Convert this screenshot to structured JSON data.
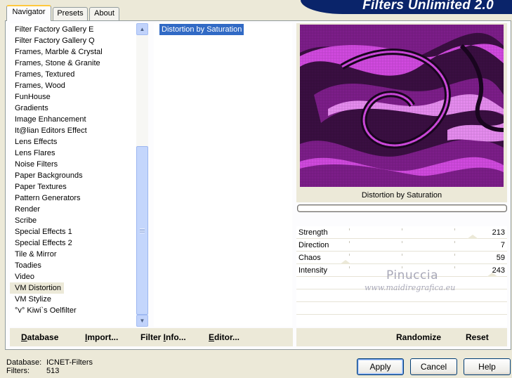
{
  "header": {
    "title": "Filters Unlimited 2.0"
  },
  "tabs": [
    {
      "label": "Navigator",
      "active": true
    },
    {
      "label": "Presets",
      "active": false
    },
    {
      "label": "About",
      "active": false
    }
  ],
  "categories": {
    "items": [
      "Filter Factory Gallery E",
      "Filter Factory Gallery Q",
      "Frames, Marble & Crystal",
      "Frames, Stone & Granite",
      "Frames, Textured",
      "Frames, Wood",
      "FunHouse",
      "Gradients",
      "Image Enhancement",
      "It@lian Editors Effect",
      "Lens Effects",
      "Lens Flares",
      "Noise Filters",
      "Paper Backgrounds",
      "Paper Textures",
      "Pattern Generators",
      "Render",
      "Scribe",
      "Special Effects 1",
      "Special Effects 2",
      "Tile & Mirror",
      "Toadies",
      "Video",
      "VM Distortion",
      "VM Stylize",
      "°v° Kiwi`s Oelfilter"
    ],
    "selected": "VM Distortion"
  },
  "filters": {
    "items": [
      "Distortion by Saturation"
    ],
    "selected": "Distortion by Saturation"
  },
  "preview": {
    "title": "Distortion by Saturation",
    "colors": {
      "dark": "#2a0a2e",
      "mid": "#7d1e8a",
      "bright": "#d24ae0",
      "light": "#e78cf0"
    }
  },
  "parameters": [
    {
      "label": "Strength",
      "value": "213",
      "level": 213
    },
    {
      "label": "Direction",
      "value": "7",
      "level": 7
    },
    {
      "label": "Chaos",
      "value": "59",
      "level": 59
    },
    {
      "label": "Intensity",
      "value": "243",
      "level": 243
    }
  ],
  "watermark": {
    "name": "Pinuccia",
    "url": "www.maidiregrafica.eu"
  },
  "left_buttons": [
    {
      "prefix": "",
      "underlined": "D",
      "rest": "atabase"
    },
    {
      "prefix": "",
      "underlined": "I",
      "rest": "mport..."
    },
    {
      "prefix": "Filter ",
      "underlined": "I",
      "rest": "nfo..."
    },
    {
      "prefix": "",
      "underlined": "E",
      "rest": "ditor..."
    }
  ],
  "right_buttons": {
    "randomize": "Randomize",
    "reset": "Reset"
  },
  "footer": {
    "database_label": "Database:",
    "database_value": "ICNET-Filters",
    "filters_label": "Filters:",
    "filters_value": "513"
  },
  "dialog_buttons": {
    "apply": "Apply",
    "cancel": "Cancel",
    "help": "Help"
  }
}
